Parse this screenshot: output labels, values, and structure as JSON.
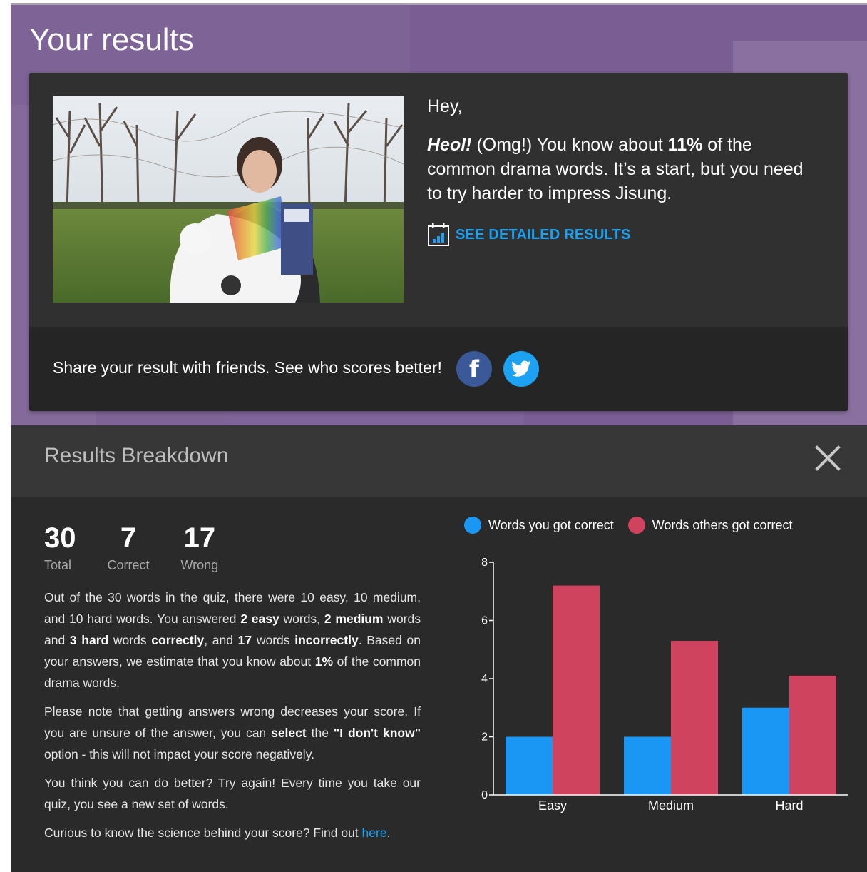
{
  "hero": {
    "title": "Your results",
    "greeting": "Hey,",
    "message": {
      "exclamation": "Heol!",
      "part1": " (Omg!) You know about ",
      "percent": "11%",
      "part2": " of the common drama words. It’s a start, but you need to try harder to impress Jisung."
    },
    "detail_link": "SEE DETAILED RESULTS",
    "detail_icon": "calendar-chart-icon",
    "share_text": "Share your result with friends. See who scores better!",
    "social": [
      {
        "name": "facebook",
        "icon": "facebook-icon",
        "glyph": "f",
        "color": "#3b5998"
      },
      {
        "name": "twitter",
        "icon": "twitter-icon",
        "color": "#1da1f2"
      }
    ]
  },
  "breakdown": {
    "title": "Results Breakdown",
    "close_icon": "close-icon",
    "stats": [
      {
        "value": "30",
        "label": "Total"
      },
      {
        "value": "7",
        "label": "Correct"
      },
      {
        "value": "17",
        "label": "Wrong"
      }
    ],
    "p1": {
      "t1": "Out of the 30 words in the quiz, there were 10 easy, 10 medium, and 10 hard words. You answered ",
      "b1": "2 easy",
      "t2": " words, ",
      "b2": "2 medium",
      "t3": " words and ",
      "b3": "3 hard",
      "t4": " words ",
      "b4": "correctly",
      "t5": ", and ",
      "b5": "17",
      "t6": " words ",
      "b6": "incorrectly",
      "t7": ". Based on your answers, we estimate that you know about ",
      "b7": "1%",
      "t8": " of the common drama words."
    },
    "p2": {
      "t1": "Please note that getting answers wrong decreases your score. If you are unsure of the answer, you can ",
      "b1": "select",
      "t2": " the ",
      "b2": "\"I don't know\"",
      "t3": " option - this will not impact your score negatively."
    },
    "p3": "You think you can do better? Try again! Every time you take our quiz, you see a new set of words.",
    "p4": {
      "t1": "Curious to know the science behind your score? Find out ",
      "link": "here",
      "t2": "."
    }
  },
  "colors": {
    "accent": "#1aa1f2",
    "user_series": "#1a97f5",
    "others_series": "#d0435f",
    "hero_bg": "#7e6396"
  },
  "chart_data": {
    "type": "bar",
    "categories": [
      "Easy",
      "Medium",
      "Hard"
    ],
    "series": [
      {
        "name": "Words you got correct",
        "values": [
          2,
          2,
          3
        ]
      },
      {
        "name": "Words others got correct",
        "values": [
          7.2,
          5.3,
          4.1
        ]
      }
    ],
    "ylim": [
      0,
      8
    ],
    "yticks": [
      "0",
      "2",
      "4",
      "6",
      "8"
    ],
    "legend": "top",
    "grid": false,
    "xlabel": "",
    "ylabel": ""
  }
}
